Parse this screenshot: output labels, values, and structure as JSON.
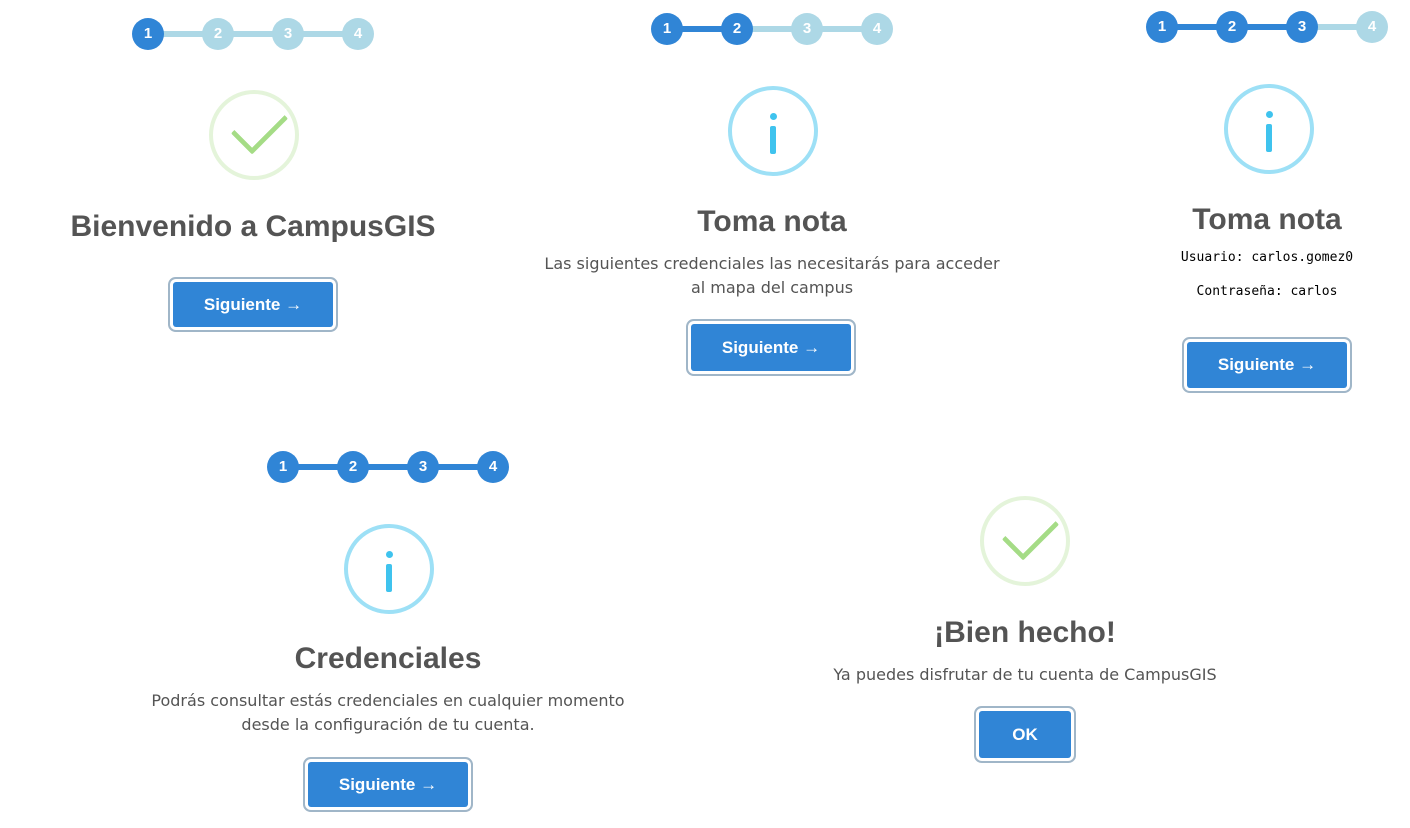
{
  "panels": [
    {
      "steps": [
        "1",
        "2",
        "3",
        "4"
      ],
      "current_step": 1,
      "icon": "success-check-icon",
      "title": "Bienvenido a CampusGIS",
      "button": "Siguiente →"
    },
    {
      "steps": [
        "1",
        "2",
        "3",
        "4"
      ],
      "current_step": 2,
      "icon": "info-icon",
      "title": "Toma nota",
      "text": "Las siguientes credenciales las necesitarás para acceder al mapa del campus",
      "button": "Siguiente →"
    },
    {
      "steps": [
        "1",
        "2",
        "3",
        "4"
      ],
      "current_step": 3,
      "icon": "info-icon",
      "title": "Toma nota",
      "username_line": "Usuario: carlos.gomez0",
      "password_line": "Contraseña: carlos",
      "button": "Siguiente →"
    },
    {
      "steps": [
        "1",
        "2",
        "3",
        "4"
      ],
      "current_step": 4,
      "icon": "info-icon",
      "title": "Credenciales",
      "text": "Podrás consultar estás credenciales en cualquier momento desde la configuración de tu cuenta.",
      "button": "Siguiente →"
    },
    {
      "icon": "success-check-icon",
      "title": "¡Bien hecho!",
      "text": "Ya puedes disfrutar de tu cuenta de CampusGIS",
      "button": "OK"
    }
  ],
  "colors": {
    "step_active": "#3085d6",
    "step_inactive": "#add8e6",
    "button": "#3085d6",
    "success": "#a5dc86",
    "info": "#3fc3ee"
  }
}
